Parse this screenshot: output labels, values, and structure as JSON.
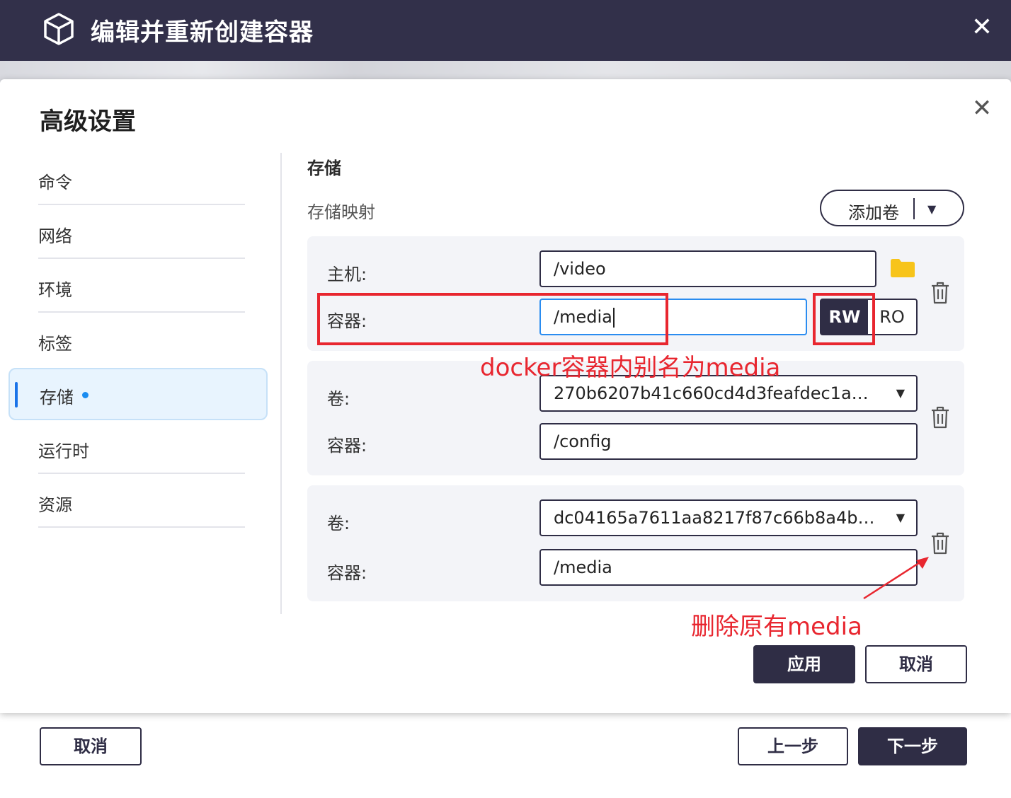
{
  "window": {
    "title": "编辑并重新创建容器",
    "close_icon": "close-icon",
    "cancel_label": "取消",
    "prev_label": "上一步",
    "next_label": "下一步"
  },
  "modal": {
    "title": "高级设置",
    "close_icon": "close-icon",
    "nav": [
      {
        "label": "命令"
      },
      {
        "label": "网络"
      },
      {
        "label": "环境"
      },
      {
        "label": "标签"
      },
      {
        "label": "存储",
        "active": true
      },
      {
        "label": "运行时"
      },
      {
        "label": "资源"
      }
    ],
    "section_title": "存储",
    "section_subtitle": "存储映射",
    "add_volume_label": "添加卷",
    "mappings": [
      {
        "source_label": "主机:",
        "source_value": "/video",
        "target_label": "容器:",
        "target_value": "/media",
        "mode_options": [
          "RW",
          "RO"
        ],
        "mode_selected": "RW"
      },
      {
        "source_label": "卷:",
        "source_value": "270b6207b41c660cd4d3feafdec1abd1a44ba6e1f6b8",
        "target_label": "容器:",
        "target_value": "/config"
      },
      {
        "source_label": "卷:",
        "source_value": "dc04165a7611aa8217f87c66b8a4ba6302f3e6c1d9a7",
        "target_label": "容器:",
        "target_value": "/media"
      }
    ],
    "apply_label": "应用",
    "cancel_label": "取消"
  },
  "annotations": {
    "alias_note": "docker容器内别名为media",
    "delete_note": "删除原有media",
    "color": "#e8262f"
  },
  "colors": {
    "titlebar": "#32304a",
    "primary": "#2f2d45",
    "active_nav_bg": "#e8f4fe",
    "accent_blue": "#1a73e8",
    "folder": "#f7c41a"
  }
}
